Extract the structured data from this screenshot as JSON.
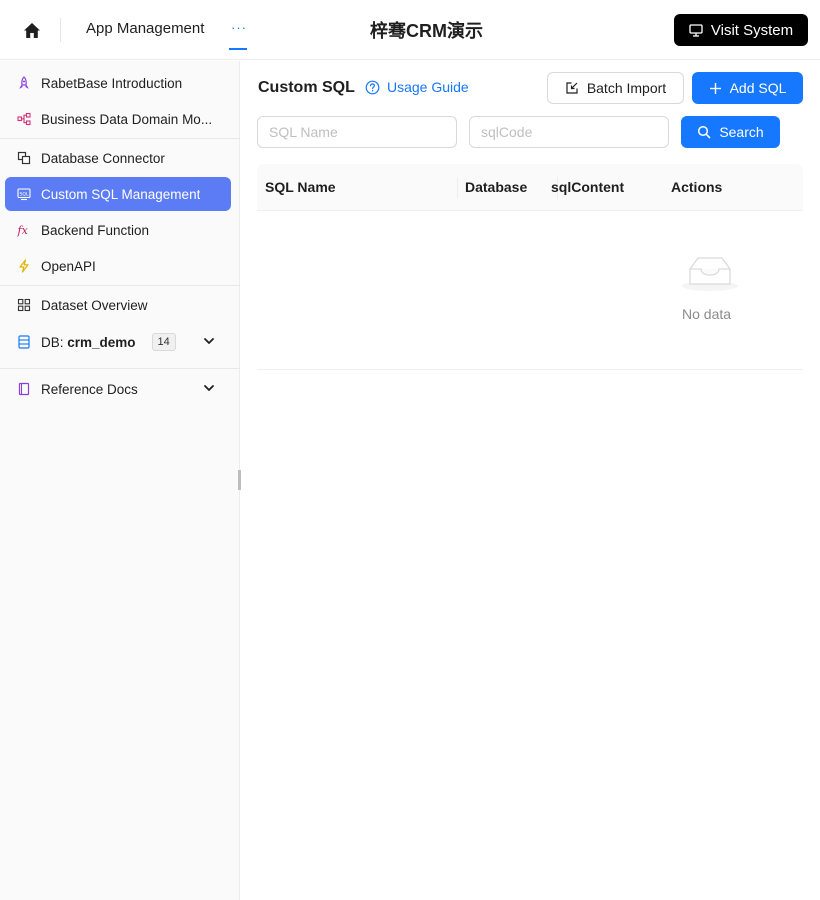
{
  "header": {
    "nav_app": "App Management",
    "nav_more": "···",
    "app_title": "梓骞CRM演示",
    "visit_label": "Visit System"
  },
  "sidebar": {
    "items": [
      {
        "label": "RabetBase Introduction",
        "icon": "rocket-icon"
      },
      {
        "label": "Business Data Domain Mo...",
        "icon": "data-model-icon"
      },
      {
        "label": "Database Connector",
        "icon": "connector-icon"
      },
      {
        "label": "Custom SQL Management",
        "icon": "sql-icon",
        "active": true
      },
      {
        "label": "Backend Function",
        "icon": "function-icon"
      },
      {
        "label": "OpenAPI",
        "icon": "lightning-icon"
      },
      {
        "label": "Dataset Overview",
        "icon": "grid-icon"
      },
      {
        "label_prefix": "DB: ",
        "label_strong": "crm_demo",
        "badge": "14",
        "icon": "database-icon"
      },
      {
        "label": "Reference Docs",
        "icon": "book-icon"
      }
    ]
  },
  "main": {
    "title": "Custom SQL",
    "usage_guide": "Usage Guide",
    "batch_import": "Batch Import",
    "add_sql": "Add SQL",
    "sql_name_placeholder": "SQL Name",
    "sql_code_placeholder": "sqlCode",
    "search": "Search",
    "columns": [
      "SQL Name",
      "Database",
      "sqlContent",
      "Actions"
    ],
    "empty_text": "No data"
  },
  "colors": {
    "accent": "#1677ff",
    "sidebar_active": "#5b7cf5",
    "visit_button": "#000000"
  }
}
